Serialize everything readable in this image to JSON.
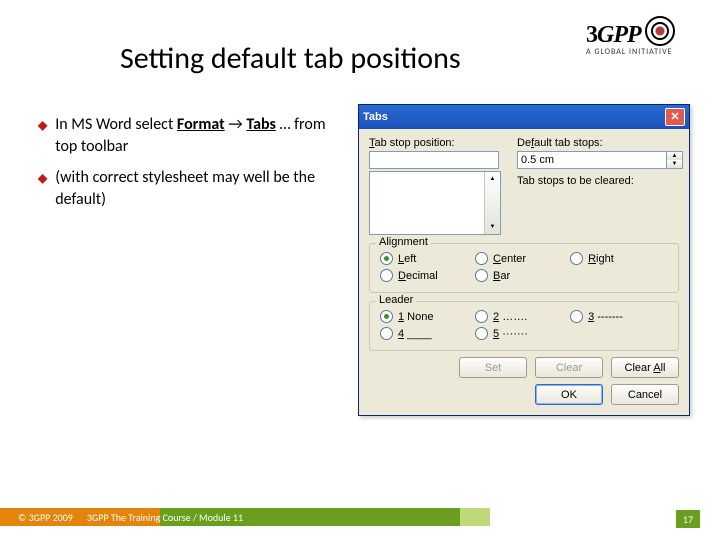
{
  "title": "Setting default tab positions",
  "logo": {
    "brand": "3GPP",
    "tagline": "A  GLOBAL  INITIATIVE"
  },
  "bullets": [
    {
      "html": "In MS Word select <u><b>Format</b></u> → <u><b>Tabs</b></u> … from top toolbar"
    },
    {
      "html": "(with correct stylesheet may well be the default)"
    }
  ],
  "dialog": {
    "title": "Tabs",
    "labels": {
      "tabstop": "Tab stop position:",
      "default": "Default tab stops:",
      "cleared": "Tab stops to be cleared:",
      "alignment": "Alignment",
      "leader": "Leader"
    },
    "default_value": "0.5 cm",
    "tabstop_value": "",
    "alignment": {
      "selected": "left",
      "opts": {
        "left": "Left",
        "center": "Center",
        "right": "Right",
        "decimal": "Decimal",
        "bar": "Bar"
      }
    },
    "leader": {
      "selected": "1",
      "opts": {
        "1": "1 None",
        "2": "2 …….",
        "3": "3 -------",
        "4": "4 ____",
        "5": "5 ·······"
      }
    },
    "buttons": {
      "set": "Set",
      "clear": "Clear",
      "clear_all": "Clear All",
      "ok": "OK",
      "cancel": "Cancel"
    }
  },
  "footer": {
    "copy": "© 3GPP 2009",
    "module": "3GPP The Training Course / Module 11",
    "page": "17"
  }
}
